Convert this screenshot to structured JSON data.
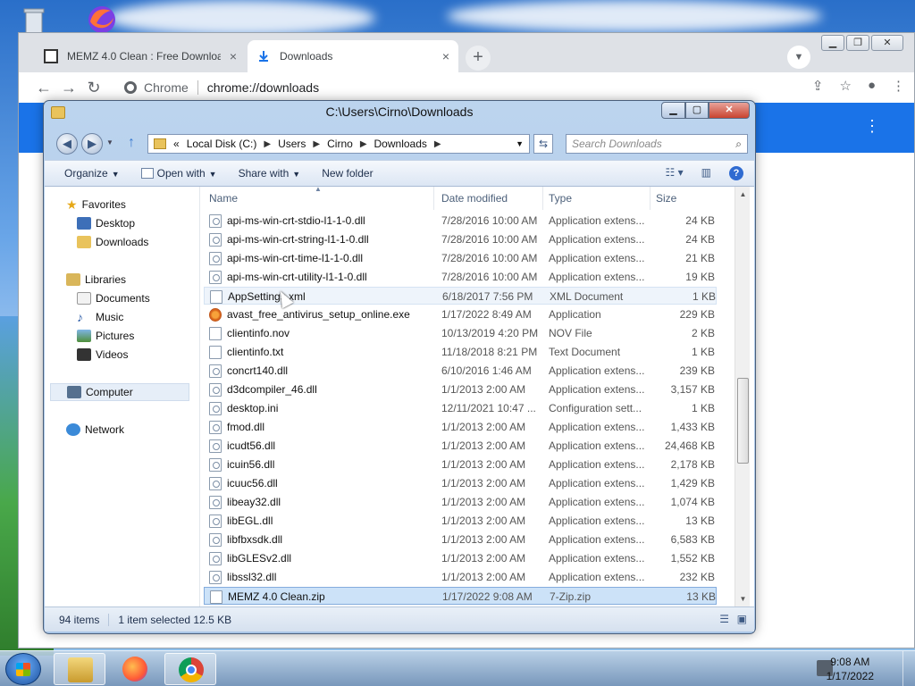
{
  "chrome": {
    "tabs": [
      {
        "title": "MEMZ 4.0 Clean : Free Downloa",
        "close": "×"
      },
      {
        "title": "Downloads",
        "close": "×"
      }
    ],
    "new_tab": "+",
    "omnibox": {
      "site": "Chrome",
      "url": "chrome://downloads"
    }
  },
  "explorer": {
    "title": "C:\\Users\\Cirno\\Downloads",
    "breadcrumb": {
      "prefix": "«",
      "parts": [
        "Local Disk (C:)",
        "Users",
        "Cirno",
        "Downloads"
      ]
    },
    "search_placeholder": "Search Downloads",
    "commands": {
      "organize": "Organize",
      "open_with": "Open with",
      "share_with": "Share with",
      "new_folder": "New folder"
    },
    "nav": {
      "favorites": "Favorites",
      "desktop": "Desktop",
      "downloads": "Downloads",
      "libraries": "Libraries",
      "documents": "Documents",
      "music": "Music",
      "pictures": "Pictures",
      "videos": "Videos",
      "computer": "Computer",
      "network": "Network"
    },
    "columns": {
      "name": "Name",
      "date": "Date modified",
      "type": "Type",
      "size": "Size"
    },
    "files": [
      {
        "name": "api-ms-win-crt-stdio-l1-1-0.dll",
        "date": "7/28/2016 10:00 AM",
        "type": "Application extens...",
        "size": "24 KB"
      },
      {
        "name": "api-ms-win-crt-string-l1-1-0.dll",
        "date": "7/28/2016 10:00 AM",
        "type": "Application extens...",
        "size": "24 KB"
      },
      {
        "name": "api-ms-win-crt-time-l1-1-0.dll",
        "date": "7/28/2016 10:00 AM",
        "type": "Application extens...",
        "size": "21 KB"
      },
      {
        "name": "api-ms-win-crt-utility-l1-1-0.dll",
        "date": "7/28/2016 10:00 AM",
        "type": "Application extens...",
        "size": "19 KB"
      },
      {
        "name": "AppSettings.xml",
        "date": "6/18/2017 7:56 PM",
        "type": "XML Document",
        "size": "1 KB"
      },
      {
        "name": "avast_free_antivirus_setup_online.exe",
        "date": "1/17/2022 8:49 AM",
        "type": "Application",
        "size": "229 KB"
      },
      {
        "name": "clientinfo.nov",
        "date": "10/13/2019 4:20 PM",
        "type": "NOV File",
        "size": "2 KB"
      },
      {
        "name": "clientinfo.txt",
        "date": "11/18/2018 8:21 PM",
        "type": "Text Document",
        "size": "1 KB"
      },
      {
        "name": "concrt140.dll",
        "date": "6/10/2016 1:46 AM",
        "type": "Application extens...",
        "size": "239 KB"
      },
      {
        "name": "d3dcompiler_46.dll",
        "date": "1/1/2013 2:00 AM",
        "type": "Application extens...",
        "size": "3,157 KB"
      },
      {
        "name": "desktop.ini",
        "date": "12/11/2021 10:47 ...",
        "type": "Configuration sett...",
        "size": "1 KB"
      },
      {
        "name": "fmod.dll",
        "date": "1/1/2013 2:00 AM",
        "type": "Application extens...",
        "size": "1,433 KB"
      },
      {
        "name": "icudt56.dll",
        "date": "1/1/2013 2:00 AM",
        "type": "Application extens...",
        "size": "24,468 KB"
      },
      {
        "name": "icuin56.dll",
        "date": "1/1/2013 2:00 AM",
        "type": "Application extens...",
        "size": "2,178 KB"
      },
      {
        "name": "icuuc56.dll",
        "date": "1/1/2013 2:00 AM",
        "type": "Application extens...",
        "size": "1,429 KB"
      },
      {
        "name": "libeay32.dll",
        "date": "1/1/2013 2:00 AM",
        "type": "Application extens...",
        "size": "1,074 KB"
      },
      {
        "name": "libEGL.dll",
        "date": "1/1/2013 2:00 AM",
        "type": "Application extens...",
        "size": "13 KB"
      },
      {
        "name": "libfbxsdk.dll",
        "date": "1/1/2013 2:00 AM",
        "type": "Application extens...",
        "size": "6,583 KB"
      },
      {
        "name": "libGLESv2.dll",
        "date": "1/1/2013 2:00 AM",
        "type": "Application extens...",
        "size": "1,552 KB"
      },
      {
        "name": "libssl32.dll",
        "date": "1/1/2013 2:00 AM",
        "type": "Application extens...",
        "size": "232 KB"
      },
      {
        "name": "MEMZ 4.0 Clean.zip",
        "date": "1/17/2022 9:08 AM",
        "type": "7-Zip.zip",
        "size": "13 KB"
      }
    ],
    "status": {
      "count": "94 items",
      "selection": "1 item selected  12.5 KB"
    }
  },
  "taskbar": {
    "time": "9:08 AM",
    "date": "1/17/2022"
  },
  "colors": {
    "chrome_accent": "#1a73e8",
    "selection": "#cce2f8",
    "explorer_frame": "#a9c5e6"
  }
}
